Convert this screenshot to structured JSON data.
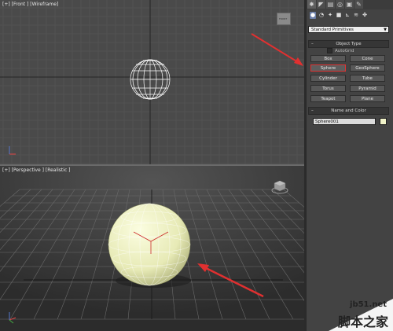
{
  "viewports": {
    "front_label": "[+] [Front ] [Wireframe]",
    "perspective_label": "[+] [Perspective ] [Realistic ]",
    "viewcube_front_text": "FRONT"
  },
  "panel": {
    "tabs": [
      "create-icon",
      "modify-icon",
      "hierarchy-icon",
      "motion-icon",
      "display-icon",
      "utilities-icon"
    ],
    "category_icons": [
      "geometry-icon",
      "shapes-icon",
      "lights-icon",
      "cameras-icon",
      "helpers-icon",
      "space-warps-icon",
      "systems-icon"
    ],
    "dropdown_value": "Standard Primitives",
    "object_type": {
      "title": "Object Type",
      "autogrid": "AutoGrid",
      "buttons": [
        "Box",
        "Cone",
        "Sphere",
        "GeoSphere",
        "Cylinder",
        "Tube",
        "Torus",
        "Pyramid",
        "Teapot",
        "Plane"
      ],
      "selected": "Sphere"
    },
    "name_and_color": {
      "title": "Name and Color",
      "name_value": "Sphere001",
      "color": "#f1f3c9"
    }
  },
  "watermark": {
    "line1": "jb51.net",
    "line2": "脚本之家"
  },
  "colors": {
    "highlight": "#dd2222",
    "arrow": "#e03030",
    "sphere": "#eef0c4"
  }
}
